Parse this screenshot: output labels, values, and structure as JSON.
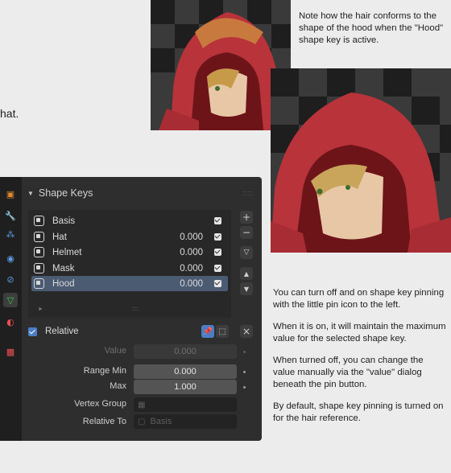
{
  "intro_fragment": "hat.",
  "note_top": "Note how the hair conforms to the shape of the hood when the \"Hood\" shape key is active.",
  "notes": [
    "You can turn off and on shape key pinning with the little pin icon to the left.",
    "When it is on, it will maintain the maximum value for the selected shape key.",
    "When turned off, you can change the value manually via the \"value\" dialog beneath the pin button.",
    "By default, shape key pinning is turned on for the hair reference."
  ],
  "panel": {
    "title": "Shape Keys",
    "header_grip": "::::",
    "list_grip": "::::",
    "keys": [
      {
        "name": "Basis",
        "value": "",
        "checked": true
      },
      {
        "name": "Hat",
        "value": "0.000",
        "checked": true
      },
      {
        "name": "Helmet",
        "value": "0.000",
        "checked": true
      },
      {
        "name": "Mask",
        "value": "0.000",
        "checked": true
      },
      {
        "name": "Hood",
        "value": "0.000",
        "checked": true
      }
    ],
    "selected_key": "Hood",
    "relative_label": "Relative",
    "relative_checked": true,
    "value_label": "Value",
    "value": "0.000",
    "range_min_label": "Range Min",
    "range_min": "0.000",
    "max_label": "Max",
    "max": "1.000",
    "vertex_group_label": "Vertex Group",
    "vertex_group": "",
    "relative_to_label": "Relative To",
    "relative_to": "Basis"
  },
  "colors": {
    "hood_red": "#b8333a",
    "panel_bg": "#2e2e2e",
    "selection": "#4a5b72",
    "accent_blue": "#4b7dc6"
  }
}
